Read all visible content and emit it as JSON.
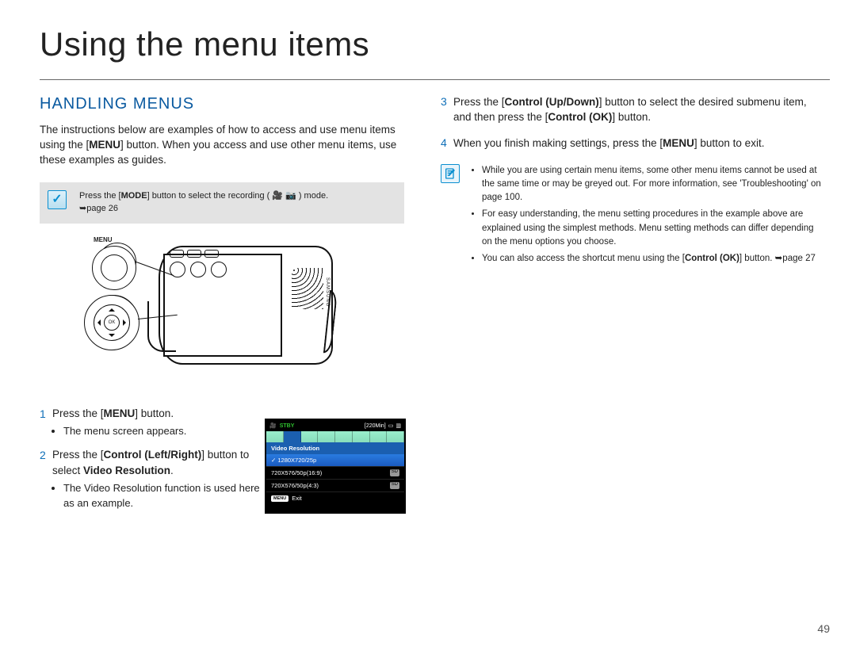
{
  "page": {
    "title": "Using the menu items",
    "number": "49"
  },
  "left": {
    "heading": "HANDLING MENUS",
    "intro_parts": [
      "The instructions below are examples of how to access and use menu items using the [",
      "MENU",
      "] button. When you access and use other menu items, use these examples as guides."
    ],
    "callout_parts": [
      "Press the [",
      "MODE",
      "] button to select the recording ( 🎥 📷 ) mode."
    ],
    "callout_page_ref": "➥page 26",
    "diagram": {
      "menu_label": "MENU",
      "ok_label": "OK"
    },
    "step1_parts": [
      "Press the [",
      "MENU",
      "] button."
    ],
    "step1_bullet": "The menu screen appears.",
    "step2_parts": [
      "Press the [",
      "Control (Left/Right)",
      "] button to select ",
      "Video Resolution",
      "."
    ],
    "step2_bullet": "The Video Resolution function is used here as an example.",
    "screen": {
      "stby": "STBY",
      "time": "[220Min]",
      "header": "Video Resolution",
      "items": [
        {
          "label": "1280X720/25p",
          "selected": true,
          "badge": ""
        },
        {
          "label": "720X576/50p(16:9)",
          "selected": false,
          "badge": "SD"
        },
        {
          "label": "720X576/50p(4:3)",
          "selected": false,
          "badge": "SD"
        }
      ],
      "exit_btn": "MENU",
      "exit_text": "Exit"
    }
  },
  "right": {
    "step3_parts": [
      "Press the [",
      "Control (Up/Down)",
      "] button to select the desired submenu item, and then press the [",
      "Control (OK)",
      "] button."
    ],
    "step4_parts": [
      "When you finish making settings, press the [",
      "MENU",
      "] button to exit."
    ],
    "notes": [
      "While you are using certain menu items, some other menu items cannot be used at the same time or may be greyed out. For more information, see 'Troubleshooting' on page 100.",
      "For easy understanding, the menu setting procedures in the example above are explained using the simplest methods. Menu setting methods can differ depending on the menu options you choose."
    ],
    "note3_parts": [
      "You can also access the shortcut menu using the [",
      "Control (OK)",
      "] button. ➥page 27"
    ]
  }
}
